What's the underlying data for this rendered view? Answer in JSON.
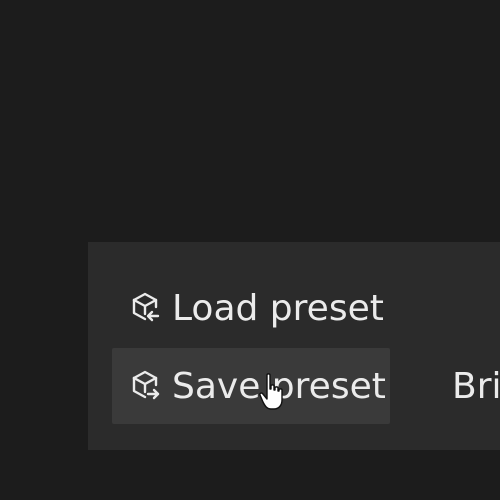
{
  "menu": {
    "load_preset": {
      "label": "Load preset",
      "icon": "cube-load-icon"
    },
    "save_preset": {
      "label": "Save preset",
      "icon": "cube-save-icon"
    },
    "brightness_partial": {
      "label": "Bri"
    }
  },
  "colors": {
    "background": "#1c1c1c",
    "panel": "#2b2b2b",
    "hover": "#3a3a3a",
    "text": "#ebebeb"
  },
  "cursor": {
    "icon": "hand-pointer-icon"
  }
}
